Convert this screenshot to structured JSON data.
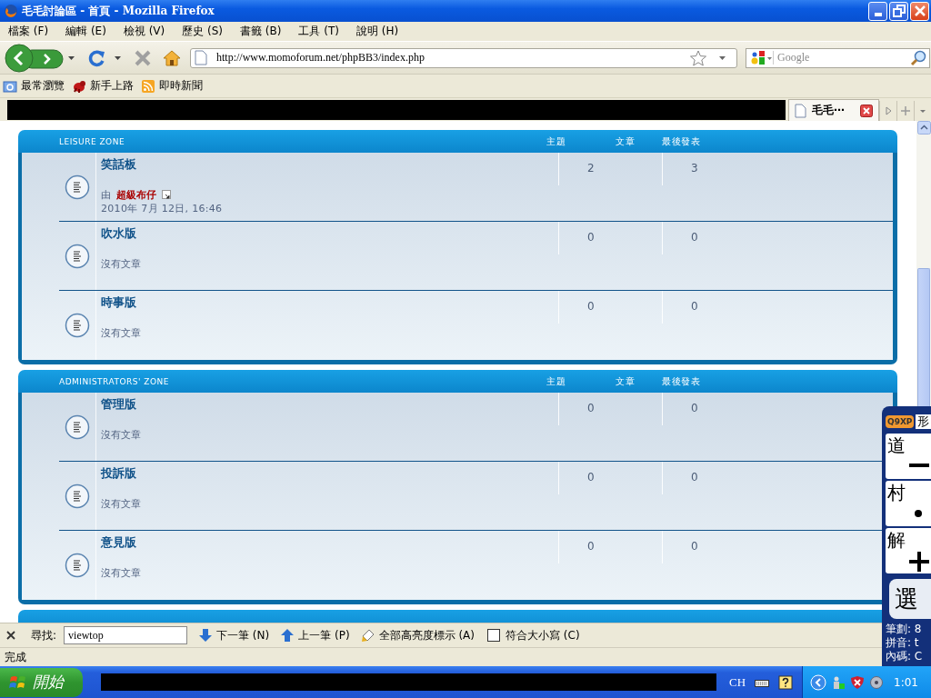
{
  "window": {
    "title": "毛毛討論區 - 首頁 - Mozilla Firefox"
  },
  "menu": [
    "檔案 (F)",
    "編輯 (E)",
    "檢視 (V)",
    "歷史 (S)",
    "書籤 (B)",
    "工具 (T)",
    "說明 (H)"
  ],
  "navigation": {
    "url": "http://www.momoforum.net/phpBB3/index.php",
    "search_placeholder": "Google"
  },
  "bookmarks": [
    {
      "label": "最常瀏覽",
      "kind": "folder"
    },
    {
      "label": "新手上路",
      "kind": "site"
    },
    {
      "label": "即時新聞",
      "kind": "feed"
    }
  ],
  "tabs": [
    {
      "label": "毛毛⋯",
      "selected": true
    }
  ],
  "sections": [
    {
      "title": "LEISURE ZONE",
      "columns": [
        "主題",
        "文章",
        "最後發表"
      ],
      "forums": [
        {
          "name": "笑話板",
          "topics": "2",
          "posts": "3",
          "last_post": {
            "prefix": "由",
            "author": "超級布仔",
            "time": "2010年 7月 12日, 16:46"
          }
        },
        {
          "name": "吹水版",
          "topics": "0",
          "posts": "0",
          "no_posts": "沒有文章"
        },
        {
          "name": "時事版",
          "topics": "0",
          "posts": "0",
          "no_posts": "沒有文章"
        }
      ]
    },
    {
      "title": "ADMINISTRATORS' ZONE",
      "columns": [
        "主題",
        "文章",
        "最後發表"
      ],
      "forums": [
        {
          "name": "管理版",
          "topics": "0",
          "posts": "0",
          "no_posts": "沒有文章"
        },
        {
          "name": "投訴版",
          "topics": "0",
          "posts": "0",
          "no_posts": "沒有文章"
        },
        {
          "name": "意見版",
          "topics": "0",
          "posts": "0",
          "no_posts": "沒有文章"
        }
      ]
    },
    {
      "partial": true
    }
  ],
  "find_bar": {
    "label": "尋找:",
    "value": "viewtop",
    "buttons": [
      {
        "label": "下一筆 (N)",
        "kind": "next"
      },
      {
        "label": "上一筆 (P)",
        "kind": "previous"
      },
      {
        "label": "全部高亮度標示 (A)",
        "kind": "highlight"
      }
    ],
    "match_case": {
      "label": "符合大小寫 (C)",
      "checked": false
    }
  },
  "status_bar": "完成",
  "taskbar": {
    "start": "開始",
    "language": "CH",
    "clock": "1:01"
  },
  "ime_panel": {
    "badge": "Q9XP",
    "mode": "形",
    "keys": [
      {
        "char": "道",
        "kind": "minus"
      },
      {
        "char": "村",
        "kind": "dot"
      },
      {
        "char": "解",
        "kind": "plus"
      }
    ],
    "select": "選",
    "info": [
      "筆劃: 8",
      "拼音: t",
      "內碼: C"
    ]
  }
}
